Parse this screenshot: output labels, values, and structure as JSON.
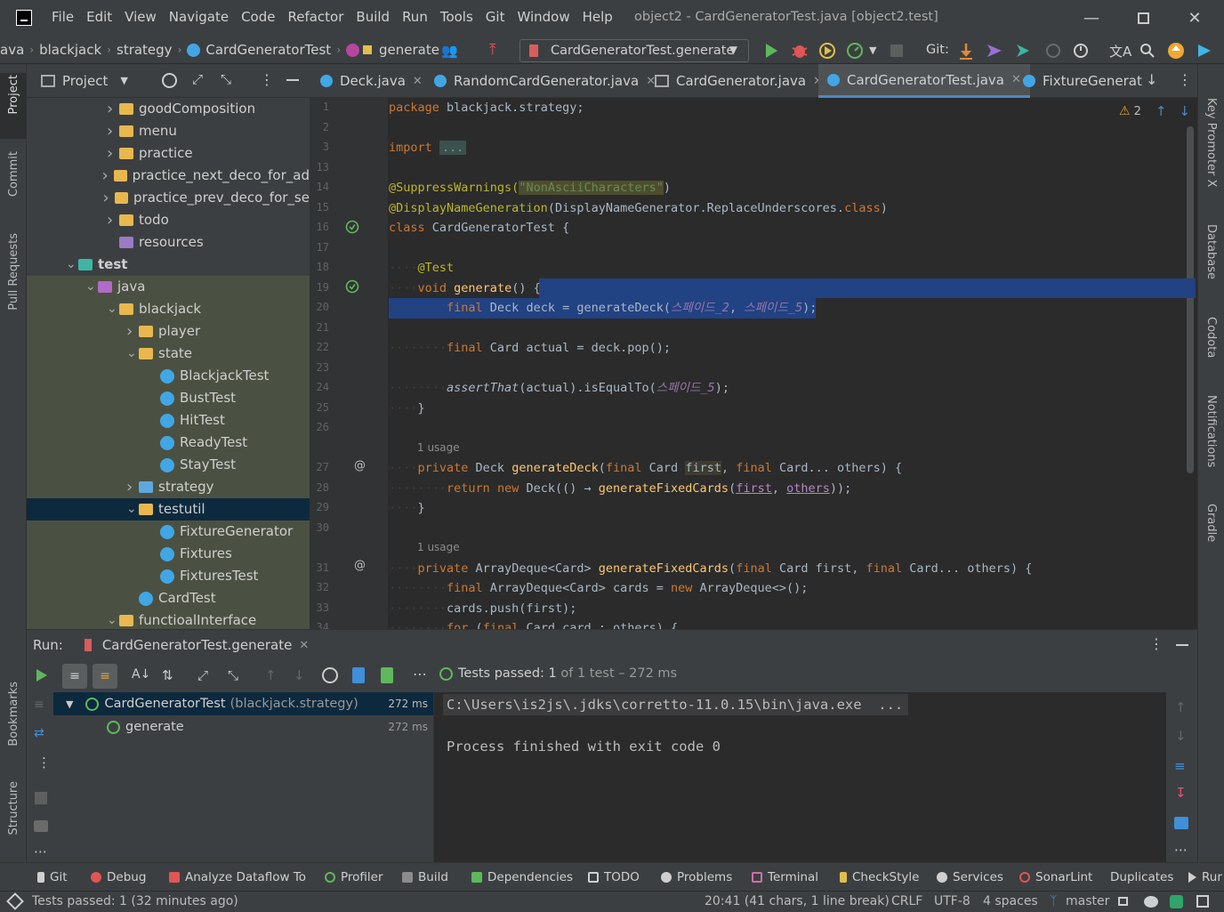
{
  "app": {
    "menu": [
      "File",
      "Edit",
      "View",
      "Navigate",
      "Code",
      "Refactor",
      "Build",
      "Run",
      "Tools",
      "Git",
      "Window",
      "Help"
    ],
    "title": "object2 - CardGeneratorTest.java [object2.test]"
  },
  "breadcrumb": [
    "ava",
    "blackjack",
    "strategy",
    "CardGeneratorTest",
    "generate"
  ],
  "run_config": "CardGeneratorTest.generate",
  "git_label": "Git:",
  "left_stripe": [
    "Project",
    "Commit",
    "Pull Requests",
    "Bookmarks",
    "Structure"
  ],
  "right_stripe": [
    "Key Promoter X",
    "Database",
    "Codota",
    "Notifications",
    "Gradle"
  ],
  "project": {
    "title": "Project",
    "tree": [
      {
        "label": "goodComposition",
        "kind": "folder"
      },
      {
        "label": "menu",
        "kind": "folder"
      },
      {
        "label": "practice",
        "kind": "folder"
      },
      {
        "label": "practice_next_deco_for_ad",
        "kind": "folder"
      },
      {
        "label": "practice_prev_deco_for_se",
        "kind": "folder"
      },
      {
        "label": "todo",
        "kind": "folder"
      },
      {
        "label": "resources",
        "kind": "res"
      },
      {
        "label": "test",
        "kind": "test"
      },
      {
        "label": "java",
        "kind": "java"
      },
      {
        "label": "blackjack",
        "kind": "folder"
      },
      {
        "label": "player",
        "kind": "folder"
      },
      {
        "label": "state",
        "kind": "folder"
      },
      {
        "label": "BlackjackTest",
        "kind": "class"
      },
      {
        "label": "BustTest",
        "kind": "class"
      },
      {
        "label": "HitTest",
        "kind": "class"
      },
      {
        "label": "ReadyTest",
        "kind": "class"
      },
      {
        "label": "StayTest",
        "kind": "class"
      },
      {
        "label": "strategy",
        "kind": "folder"
      },
      {
        "label": "testutil",
        "kind": "folder"
      },
      {
        "label": "FixtureGenerator",
        "kind": "class"
      },
      {
        "label": "Fixtures",
        "kind": "class"
      },
      {
        "label": "FixturesTest",
        "kind": "class"
      },
      {
        "label": "CardTest",
        "kind": "class"
      },
      {
        "label": "functioalInterface",
        "kind": "folder"
      }
    ]
  },
  "tabs": [
    {
      "label": "Deck.java"
    },
    {
      "label": "RandomCardGenerator.java"
    },
    {
      "label": "CardGenerator.java"
    },
    {
      "label": "CardGeneratorTest.java"
    },
    {
      "label": "FixtureGenerat"
    }
  ],
  "editor": {
    "warnings": "2",
    "line_numbers": [
      "1",
      "2",
      "3",
      "13",
      "14",
      "15",
      "16",
      "17",
      "18",
      "19",
      "20",
      "21",
      "22",
      "23",
      "24",
      "25",
      "26",
      "27",
      "28",
      "29",
      "30",
      "31",
      "32",
      "33",
      "34"
    ],
    "usage_label": "1 usage",
    "lines": {
      "l1_kw": "package",
      "l1_rest": " blackjack.strategy;",
      "l3_kw": "import",
      "l3_fold": "...",
      "l14_an": "@SuppressWarnings(",
      "l14_str": "\"NonAsciiCharacters\"",
      "l14_end": ")",
      "l15_an": "@DisplayNameGeneration",
      "l15_rest": "(DisplayNameGenerator.ReplaceUnderscores.",
      "l15_kw": "class",
      "l15_end": ")",
      "l16_kw": "class",
      "l16_rest": " CardGeneratorTest {",
      "l18_an": "@Test",
      "l19_kw": "void",
      "l19_fn": "generate",
      "l19_rest": "() {",
      "l20_kw": "final",
      "l20_a": " Deck deck = generateDeck(",
      "l20_k1": "스페이드_2",
      "l20_c": ", ",
      "l20_k2": "스페이드_5",
      "l20_end": ");",
      "l22_kw": "final",
      "l22_rest": " Card actual = deck.pop();",
      "l24_it": "assertThat",
      "l24_a": "(actual).isEqualTo(",
      "l24_k": "스페이드_5",
      "l24_end": ");",
      "l25": "}",
      "l27_kw": "private",
      "l27_a": " Deck ",
      "l27_fn": "generateDeck",
      "l27_b": "(",
      "l27_kw2": "final",
      "l27_c": " Card ",
      "l27_first": "first",
      "l27_d": ", ",
      "l27_kw3": "final",
      "l27_e": " Card... ",
      "l27_others": "others",
      "l27_end": ") {",
      "l28_kw": "return",
      "l28_kw2": "new",
      "l28_a": " Deck(() → ",
      "l28_fn": "generateFixedCards",
      "l28_b": "(",
      "l28_first": "first",
      "l28_c": ", ",
      "l28_others": "others",
      "l28_end": "));",
      "l29": "}",
      "l31_kw": "private",
      "l31_a": " ArrayDeque<Card> ",
      "l31_fn": "generateFixedCards",
      "l31_b": "(",
      "l31_kw2": "final",
      "l31_c": " Card first, ",
      "l31_kw3": "final",
      "l31_d": " Card... others) {",
      "l32_kw": "final",
      "l32_a": " ArrayDeque<Card> cards = ",
      "l32_kw2": "new",
      "l32_b": " ArrayDeque<>();",
      "l33": "cards.push(first);",
      "l34_kw": "for",
      "l34_a": " (",
      "l34_kw2": "final",
      "l34_b": " Card card : others) {"
    }
  },
  "run": {
    "label": "Run:",
    "tab": "CardGeneratorTest.generate",
    "status_prefix": "Tests passed: ",
    "status_count": "1",
    "status_suffix": " of 1 test – 272 ms",
    "tree": [
      {
        "label": "CardGeneratorTest",
        "sub": "(blackjack.strategy)",
        "time": "272 ms"
      },
      {
        "label": "generate",
        "sub": "",
        "time": "272 ms"
      }
    ],
    "console": [
      "C:\\Users\\is2js\\.jdks\\corretto-11.0.15\\bin\\java.exe  ...",
      "Process finished with exit code 0"
    ]
  },
  "bottom_tools": [
    "Git",
    "Debug",
    "Analyze Dataflow To",
    "Profiler",
    "Build",
    "Dependencies",
    "TODO",
    "Problems",
    "Terminal",
    "CheckStyle",
    "Services",
    "SonarLint",
    "Duplicates",
    "Rur"
  ],
  "status": {
    "left": "Tests passed: 1 (32 minutes ago)",
    "position": "20:41 (41 chars, 1 line break)",
    "line_sep": "CRLF",
    "encoding": "UTF-8",
    "indent": "4 spaces",
    "branch": "master"
  },
  "colors": {
    "accent": "#4a88c7",
    "selection": "#214283",
    "keyword": "#cc7832",
    "string": "#6a8759",
    "function": "#ffc66d",
    "annotation": "#bbb529",
    "pass": "#5fb85c"
  }
}
